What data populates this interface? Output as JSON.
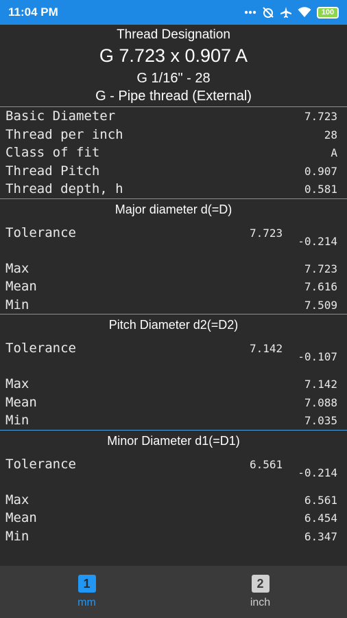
{
  "status_bar": {
    "time": "11:04 PM",
    "battery": "100"
  },
  "header": {
    "title": "Thread Designation",
    "designation": "G 7.723 x 0.907   A",
    "size": "G 1/16\" - 28",
    "type": "G - Pipe thread (External)"
  },
  "basic": [
    {
      "label": "Basic Diameter",
      "value": "7.723"
    },
    {
      "label": "Thread per inch",
      "value": "28"
    },
    {
      "label": "Class of fit",
      "value": "A"
    },
    {
      "label": "Thread Pitch",
      "value": "0.907"
    },
    {
      "label": "Thread depth, h",
      "value": "0.581"
    }
  ],
  "sections": [
    {
      "title": "Major diameter d(=D)",
      "tolerance_label": "Tolerance",
      "nominal": "7.723",
      "deviation": "-0.214",
      "max_label": "Max",
      "max": "7.723",
      "mean_label": "Mean",
      "mean": "7.616",
      "min_label": "Min",
      "min": "7.509"
    },
    {
      "title": "Pitch Diameter d2(=D2)",
      "tolerance_label": "Tolerance",
      "nominal": "7.142",
      "deviation": "-0.107",
      "max_label": "Max",
      "max": "7.142",
      "mean_label": "Mean",
      "mean": "7.088",
      "min_label": "Min",
      "min": "7.035"
    },
    {
      "title": "Minor Diameter d1(=D1)",
      "tolerance_label": "Tolerance",
      "nominal": "6.561",
      "deviation": "-0.214",
      "max_label": "Max",
      "max": "6.561",
      "mean_label": "Mean",
      "mean": "6.454",
      "min_label": "Min",
      "min": "6.347"
    }
  ],
  "tabs": [
    {
      "icon": "1",
      "label": "mm",
      "active": true
    },
    {
      "icon": "2",
      "label": "inch",
      "active": false
    }
  ],
  "colors": {
    "accent": "#1e88e5",
    "active_tab": "#2196f3",
    "inactive_tab": "#d0d0d0",
    "background": "#2b2b2b",
    "divider": "#4aa3df"
  }
}
